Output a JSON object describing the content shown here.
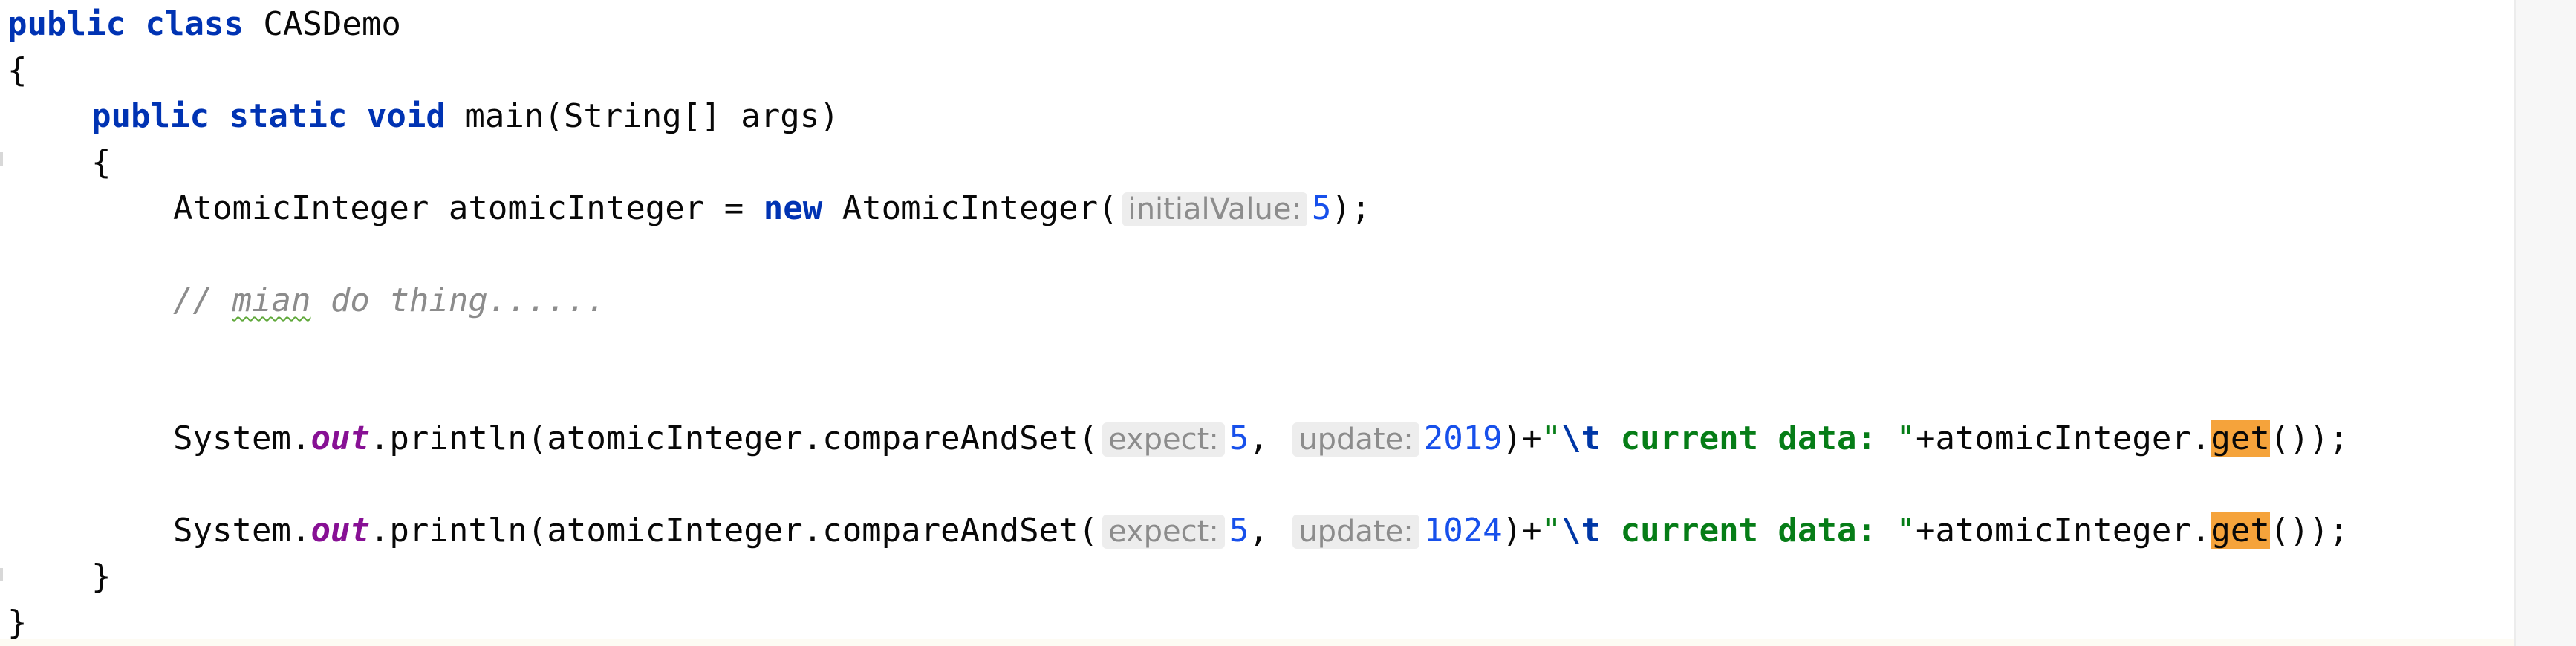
{
  "code": {
    "class_decl": {
      "kw_public": "public",
      "kw_class": "class",
      "name": "CASDemo"
    },
    "open_brace_class": "{",
    "method_decl": {
      "kw_public": "public",
      "kw_static": "static",
      "kw_void": "void",
      "signature": "main(String[] args)"
    },
    "open_brace_method": "{",
    "line_atomic": {
      "decl": "AtomicInteger atomicInteger = ",
      "kw_new": "new",
      "ctor": "AtomicInteger(",
      "hint": "initialValue:",
      "value": "5",
      "end": ");"
    },
    "comment": {
      "prefix": "// ",
      "word": "mian",
      "rest": " do thing......"
    },
    "println_1": {
      "system": "System.",
      "out": "out",
      "call": ".println(atomicInteger.compareAndSet(",
      "hint_expect": "expect:",
      "expect": "5",
      "comma": ", ",
      "hint_update": "update:",
      "update": "2019",
      "concat1": ")+",
      "quote_open": "\"",
      "escape": "\\t",
      "str_text": " current data: ",
      "quote_close": "\"",
      "concat2": "+atomicInteger.",
      "get": "get",
      "end": "());"
    },
    "println_2": {
      "system": "System.",
      "out": "out",
      "call": ".println(atomicInteger.compareAndSet(",
      "hint_expect": "expect:",
      "expect": "5",
      "comma": ", ",
      "hint_update": "update:",
      "update": "1024",
      "concat1": ")+",
      "quote_open": "\"",
      "escape": "\\t",
      "str_text": " current data: ",
      "quote_close": "\"",
      "concat2": "+atomicInteger.",
      "get": "get",
      "end": "());"
    },
    "close_brace_method": "}",
    "close_brace_class": "}"
  },
  "colors": {
    "keyword": "#0033b3",
    "static_field": "#871094",
    "number": "#1750eb",
    "string": "#067d17",
    "comment": "#8c8c8c",
    "search_highlight": "#f5a33b",
    "inlay_hint_bg": "#ededed"
  }
}
